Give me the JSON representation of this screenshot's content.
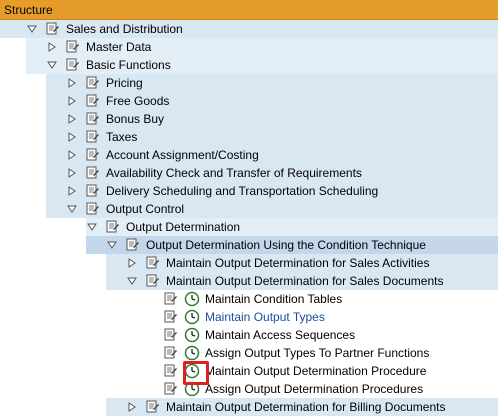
{
  "header": {
    "title": "Structure"
  },
  "tree": {
    "sales_and_distribution": "Sales and Distribution",
    "master_data": "Master Data",
    "basic_functions": "Basic Functions",
    "pricing": "Pricing",
    "free_goods": "Free Goods",
    "bonus_buy": "Bonus Buy",
    "taxes": "Taxes",
    "account_assignment": "Account Assignment/Costing",
    "availability_check": "Availability Check and Transfer of Requirements",
    "delivery_scheduling": "Delivery Scheduling and Transportation Scheduling",
    "output_control": "Output Control",
    "output_determination": "Output Determination",
    "output_det_condition_technique": "Output Determination Using the Condition Technique",
    "maintain_od_sales_activities": "Maintain Output Determination for Sales Activities",
    "maintain_od_sales_documents": "Maintain Output Determination for Sales Documents",
    "maintain_condition_tables": "Maintain Condition Tables",
    "maintain_output_types": "Maintain Output Types",
    "maintain_access_sequences": "Maintain Access Sequences",
    "assign_output_types_partner": "Assign Output Types To Partner Functions",
    "maintain_od_procedure": "Maintain Output Determination Procedure",
    "assign_od_procedures": "Assign Output Determination Procedures",
    "maintain_od_billing_documents": "Maintain Output Determination for Billing Documents"
  },
  "colors": {
    "header_bg": "#e69c2a",
    "link_text": "#1a4f9c",
    "focus_box": "#e02020"
  }
}
